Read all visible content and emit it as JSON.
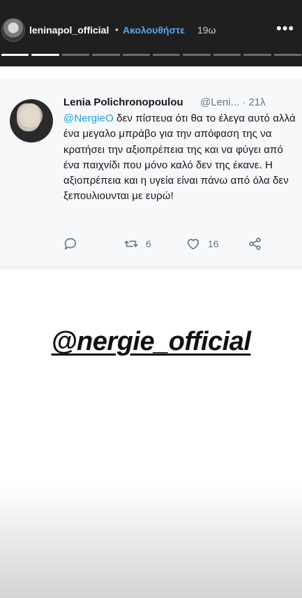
{
  "story": {
    "username": "leninapol_official",
    "separator": "•",
    "follow_label": "Ακολουθήστε",
    "time_ago": "19ω",
    "more": "•••"
  },
  "tweet": {
    "name": "Lenia Polichronopoulou",
    "handle_time": "@Leni... · 21λ",
    "mention": "@NergieO",
    "body": " δεν πίστευα ότι θα το έλεγα αυτό αλλά ένα μεγαλο μπράβο για την απόφαση της να κρατήσει την αξιοπρέπεια της και να φύγει από ένα παιχνίδι που μόνο καλό δεν της έκανε. Η αξιοπρέπεια και η υγεία είναι πάνω από όλα δεν ξεπουλιουνται με ευρώ!",
    "retweets": "6",
    "likes": "16"
  },
  "overlay_tag": "@nergie_official",
  "colors": {
    "accent": "#57a6f0",
    "twitter_blue": "#1da1f2",
    "icon_gray": "#657786"
  },
  "icons": [
    "reply-icon",
    "retweet-icon",
    "like-icon",
    "share-icon",
    "more-options-icon"
  ]
}
